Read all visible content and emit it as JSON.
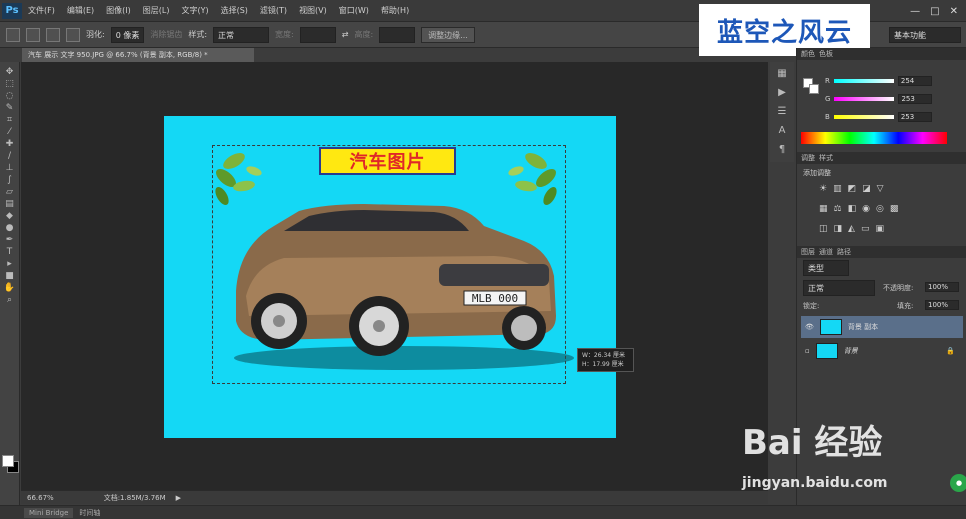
{
  "app": {
    "logo": "Ps"
  },
  "menu": [
    "文件(F)",
    "编辑(E)",
    "图像(I)",
    "图层(L)",
    "文字(Y)",
    "选择(S)",
    "滤镜(T)",
    "视图(V)",
    "窗口(W)",
    "帮助(H)"
  ],
  "window_controls": [
    "—",
    "□",
    "✕"
  ],
  "options": {
    "feather_label": "羽化:",
    "feather_value": "0 像素",
    "antialias_label": "消除锯齿",
    "style_label": "样式:",
    "style_value": "正常",
    "width_label": "宽度:",
    "height_label": "高度:",
    "refine_edge": "调整边缘..."
  },
  "watermark_logo": "蓝空之风云",
  "workspace": "基本功能",
  "document_tab": "汽车 展示 文字 950.JPG @ 66.7% (背景 副本, RGB/8) *",
  "canvas": {
    "title_text": "汽车图片",
    "dims_tooltip_w": "W：26.34 厘米",
    "dims_tooltip_h": "H：17.99 厘米"
  },
  "status": {
    "zoom": "66.67%",
    "doc_info": "文档:1.85M/3.76M"
  },
  "bottom_tabs": [
    "Mini Bridge",
    "时间轴"
  ],
  "color_panel": {
    "tabs": [
      "颜色",
      "色板"
    ],
    "r_label": "R",
    "g_label": "G",
    "b_label": "B",
    "r_value": "254",
    "g_value": "253",
    "b_value": "253"
  },
  "adjust_panel": {
    "tabs": [
      "调整",
      "样式"
    ],
    "heading": "添加调整"
  },
  "layers_panel": {
    "tabs": [
      "图层",
      "通道",
      "路径"
    ],
    "kind": "类型",
    "blend_mode": "正常",
    "opacity_label": "不透明度:",
    "opacity_value": "100%",
    "lock_label": "锁定:",
    "fill_label": "填充:",
    "fill_value": "100%",
    "layers": [
      {
        "name": "背景 副本",
        "selected": true
      },
      {
        "name": "背景",
        "selected": false
      }
    ]
  },
  "baidu": {
    "logo": "Bai 经验",
    "url": "jingyan.baidu.com"
  },
  "colors": {
    "canvas_bg": "#14d8f5",
    "title_box": "#ffe811",
    "title_text": "#e02828",
    "watermark_text": "#1d57b8"
  }
}
